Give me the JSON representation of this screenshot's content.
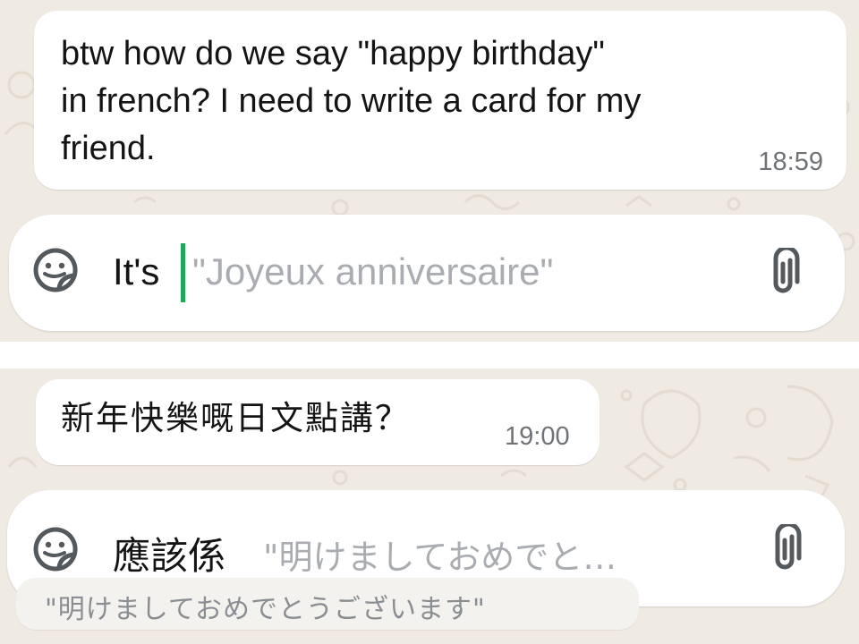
{
  "colors": {
    "chat_background": "#efeae2",
    "bubble": "#ffffff",
    "caret": "#1fa855",
    "placeholder_text": "#a9adb1",
    "timestamp": "#6f7378"
  },
  "top": {
    "message": {
      "line1": "btw how do we say \"happy birthday\"",
      "line2": "in french? I need to write a card for my",
      "line3": "friend.",
      "time": "18:59"
    },
    "composer": {
      "sticker_icon": "sticker-icon",
      "typed_text": "It's",
      "suggested_completion": "\"Joyeux anniversaire\"",
      "attach_icon": "paperclip-icon"
    }
  },
  "bottom": {
    "message": {
      "text": "新年快樂嘅日文點講？",
      "time": "19:00"
    },
    "composer": {
      "sticker_icon": "sticker-icon",
      "typed_text": "應該係",
      "suggested_completion": "\"明けましておめでと…",
      "attach_icon": "paperclip-icon"
    },
    "suggestion_chip": "\"明けましておめでとうございます\""
  }
}
